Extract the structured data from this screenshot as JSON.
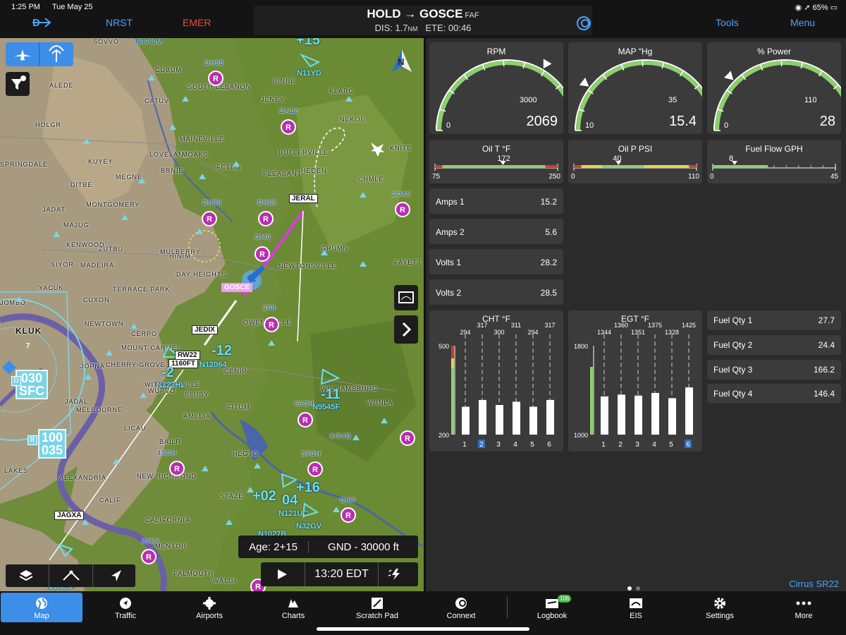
{
  "status": {
    "time": "1:25 PM",
    "date": "Tue May 25",
    "battery": "65%"
  },
  "topbar": {
    "nrst": "NRST",
    "emer": "EMER",
    "title": "HOLD → GOSCE",
    "title_suffix": "FAF",
    "dis_label": "DIS: 1.7",
    "dis_unit": "NM",
    "ete": "ETE: 00:46",
    "tools": "Tools",
    "menu": "Menu"
  },
  "map": {
    "places": [
      "SOVVO",
      "CUBUM",
      "ALEDE",
      "CATUV",
      "HOLGR",
      "SOUTH LEBANON",
      "JENEY",
      "SINRE",
      "KLARC",
      "NEKOE",
      "MAINEVILLE",
      "LOVELAND",
      "MOAKS",
      "BUTLERVILLE",
      "KNITE",
      "KUYEY",
      "BRNIE",
      "FETEG",
      "PLEASANT",
      "HEDEN",
      "MEGNE",
      "CHMLE",
      "DITBE",
      "JADAT",
      "MONTGOMERY",
      "MAJUG",
      "KENWOOD",
      "ZUTBU",
      "SIYOR",
      "MADEIRA",
      "HINIM",
      "MULBERRY",
      "DAY HEIGHTS",
      "NEWTONSVILLE",
      "GRUMN",
      "FAYETT",
      "YACUK",
      "TERRACE PARK",
      "CUXON",
      "JOMBO",
      "NEWTOWN",
      "KLUK",
      "CERPO",
      "MOUNT CARMEL",
      "OWENSVILLE",
      "JOPNA",
      "CHERRY GROVE",
      "WITHAMSVILLE",
      "CENIP",
      "WUPVO",
      "SLUBY",
      "FITUM",
      "WILLIAMSBURG",
      "WUNLA",
      "JADAL",
      "MELBOURNE",
      "AMELIA",
      "LICAU",
      "BAILR",
      "HEGTO",
      "NEW RICHMOND",
      "ALEXANDRIA",
      "CALIF",
      "STAZE",
      "CALIFORNIA",
      "MENTOR",
      "WALGI",
      "FALMOUTH",
      "SPRINGDALE",
      "LAKES",
      "N904LM",
      "N11YD",
      "N9545F",
      "N12064",
      "N223HL",
      "N121UC",
      "N32GV",
      "N1027B",
      "N302SP"
    ],
    "waypoints": {
      "jeral": "JERAL",
      "gosce": "GOSCE",
      "jedix": "JEDIX",
      "rw22": "RW22",
      "alt_1160": "1160FT",
      "jagxa": "JAGXA"
    },
    "airports": [
      "OH95",
      "OA12",
      "OH66",
      "OH65",
      "OI40",
      "2I0I",
      "2OA2",
      "66OH",
      "KI54Q",
      "59OH",
      "45OH",
      "29KY",
      "OI57"
    ],
    "traffic": {
      "t1": "+15",
      "t2": "-12",
      "t3": "-2",
      "t4": "-11",
      "t5": "+02",
      "t6": "04",
      "t7": "+16",
      "t8": "+02",
      "t9": "140"
    },
    "boxes": {
      "b1_top": "030",
      "b1_bot": "SFC",
      "b2_top": "100",
      "b2_bot": "035",
      "b_label_d": "D",
      "b_label_b": "B",
      "seven": "7"
    },
    "north": "N",
    "age": "Age: 2+15",
    "range": "GND - 30000 ft",
    "time": "13:20 EDT"
  },
  "eis": {
    "rpm": {
      "title": "RPM",
      "value": "2069",
      "min": "0",
      "max": "3000",
      "fraction": 0.69
    },
    "map": {
      "title": "MAP \"Hg",
      "value": "15.4",
      "min": "10",
      "max": "35",
      "fraction": 0.216
    },
    "power": {
      "title": "% Power",
      "value": "28",
      "min": "0",
      "max": "110",
      "fraction": 0.255
    },
    "oil_t": {
      "title": "Oil T °F",
      "value": "172",
      "min": "75",
      "max": "250",
      "fraction": 0.554
    },
    "oil_p": {
      "title": "Oil P PSI",
      "value": "40",
      "min": "0",
      "max": "110",
      "fraction": 0.364
    },
    "fuel_flow": {
      "title": "Fuel Flow GPH",
      "value": "8",
      "min": "0",
      "max": "45",
      "fraction": 0.178
    },
    "rows": [
      {
        "label": "Amps 1",
        "value": "15.2"
      },
      {
        "label": "Amps 2",
        "value": "5.6"
      },
      {
        "label": "Volts 1",
        "value": "28.2"
      },
      {
        "label": "Volts 2",
        "value": "28.5"
      }
    ],
    "cht": {
      "title": "CHT °F",
      "max": "500",
      "min": "200",
      "cylinders": [
        "1",
        "2",
        "3",
        "4",
        "5",
        "6"
      ],
      "values": [
        "294",
        "317",
        "300",
        "311",
        "294",
        "317"
      ],
      "hot": 1
    },
    "egt": {
      "title": "EGT °F",
      "max": "1800",
      "min": "1000",
      "cylinders": [
        "1",
        "2",
        "3",
        "4",
        "5",
        "6"
      ],
      "values": [
        "1344",
        "1360",
        "1351",
        "1375",
        "1328",
        "1425"
      ],
      "hot": 5
    },
    "fuel": [
      {
        "label": "Fuel Qty 1",
        "value": "27.7"
      },
      {
        "label": "Fuel Qty 2",
        "value": "24.4"
      },
      {
        "label": "Fuel Qty 3",
        "value": "166.2"
      },
      {
        "label": "Fuel Qty 4",
        "value": "146.4"
      }
    ],
    "aircraft": "Cirrus SR22"
  },
  "tabs": [
    {
      "label": "Map"
    },
    {
      "label": "Traffic"
    },
    {
      "label": "Airports"
    },
    {
      "label": "Charts"
    },
    {
      "label": "Scratch Pad"
    },
    {
      "label": "Connext"
    },
    {
      "label": "Logbook",
      "badge": "106"
    },
    {
      "label": "EIS"
    },
    {
      "label": "Settings"
    },
    {
      "label": "More"
    }
  ],
  "colors": {
    "accent": "#3c8ee8",
    "route": "#d63ce0",
    "traffic": "#68e0ee",
    "gauge_green": "#8ccf6e",
    "gauge_red": "#d23a2a"
  }
}
